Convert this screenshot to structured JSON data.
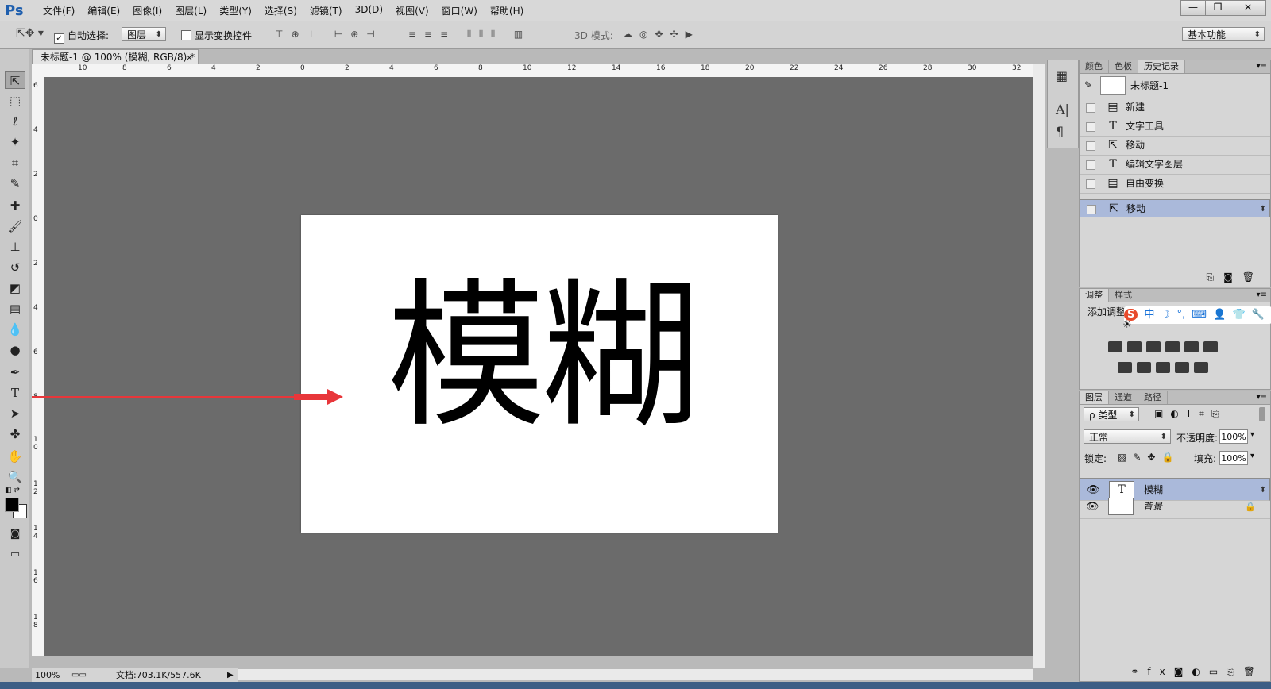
{
  "app": {
    "logo": "Ps",
    "menu": [
      "文件(F)",
      "编辑(E)",
      "图像(I)",
      "图层(L)",
      "类型(Y)",
      "选择(S)",
      "滤镜(T)",
      "3D(D)",
      "视图(V)",
      "窗口(W)",
      "帮助(H)"
    ],
    "window_controls": [
      "—",
      "❐",
      "✕"
    ]
  },
  "options": {
    "auto_select_label": "自动选择:",
    "auto_select_value": "图层",
    "show_transform_label": "显示变换控件",
    "mode_3d_label": "3D 模式:",
    "workspace_value": "基本功能"
  },
  "document": {
    "tab_title": "未标题-1 @ 100% (模糊, RGB/8) *",
    "close": "×",
    "canvas_text": "模糊",
    "zoom": "100%",
    "doc_info": "文档:703.1K/557.6K"
  },
  "rulers": {
    "top": [
      "10",
      "8",
      "6",
      "4",
      "2",
      "0",
      "2",
      "4",
      "6",
      "8",
      "10",
      "12",
      "14",
      "16",
      "18",
      "20",
      "22",
      "24",
      "26",
      "28",
      "30",
      "32"
    ],
    "left": [
      "6",
      "4",
      "2",
      "0",
      "2",
      "4",
      "6",
      "8",
      "1\n0",
      "1\n2",
      "1\n4",
      "1\n6",
      "1\n8"
    ]
  },
  "history_panel": {
    "tabs": [
      "颜色",
      "色板",
      "历史记录"
    ],
    "snapshot_label": "未标题-1",
    "items": [
      {
        "icon": "doc-icon",
        "label": "新建"
      },
      {
        "icon": "type-icon",
        "label": "文字工具"
      },
      {
        "icon": "move-icon",
        "label": "移动"
      },
      {
        "icon": "type-icon",
        "label": "编辑文字图层"
      },
      {
        "icon": "doc-icon",
        "label": "自由变换"
      },
      {
        "icon": "move-icon",
        "label": "移动"
      }
    ]
  },
  "adjust_panel": {
    "tabs": [
      "调整",
      "样式"
    ],
    "title": "添加调整",
    "ime": [
      "S",
      "中",
      "☽",
      "°,",
      "⌨",
      "👤",
      "👕",
      "🔧"
    ]
  },
  "layers_panel": {
    "tabs": [
      "图层",
      "通道",
      "路径"
    ],
    "filter_label": "ρ 类型",
    "blend_mode": "正常",
    "opacity_label": "不透明度:",
    "opacity_value": "100%",
    "lock_label": "锁定:",
    "fill_label": "填充:",
    "fill_value": "100%",
    "layers": [
      {
        "name": "模糊",
        "type": "text"
      },
      {
        "name": "背景",
        "type": "background"
      }
    ]
  },
  "colors": {
    "workspace": "#6b6b6b",
    "selection": "#aab9da",
    "arrow": "#e8363a"
  }
}
